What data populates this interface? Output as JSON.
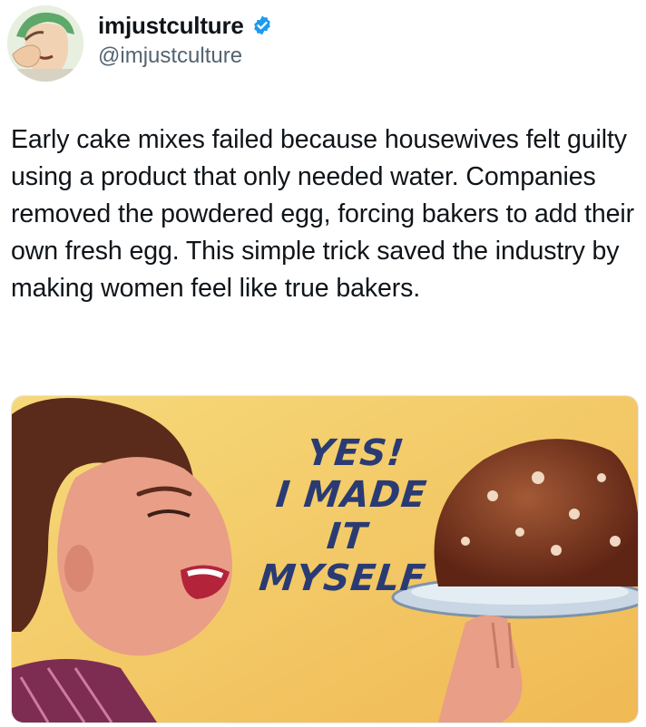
{
  "post": {
    "display_name": "imjustculture",
    "handle": "@imjustculture",
    "verified_icon": "verified-badge-icon",
    "text": "Early cake mixes failed because housewives felt guilty using a product that only needed water. Companies removed the powdered egg, forcing bakers to add their own fresh egg. This simple trick saved the industry by making women feel like true bakers."
  },
  "media": {
    "poster_lines": [
      "YES!",
      "I MADE",
      "IT",
      "MYSELF"
    ]
  },
  "colors": {
    "verified": "#1d9bf0",
    "poster_bg": "#f2c865",
    "poster_text": "#2a3b74"
  }
}
